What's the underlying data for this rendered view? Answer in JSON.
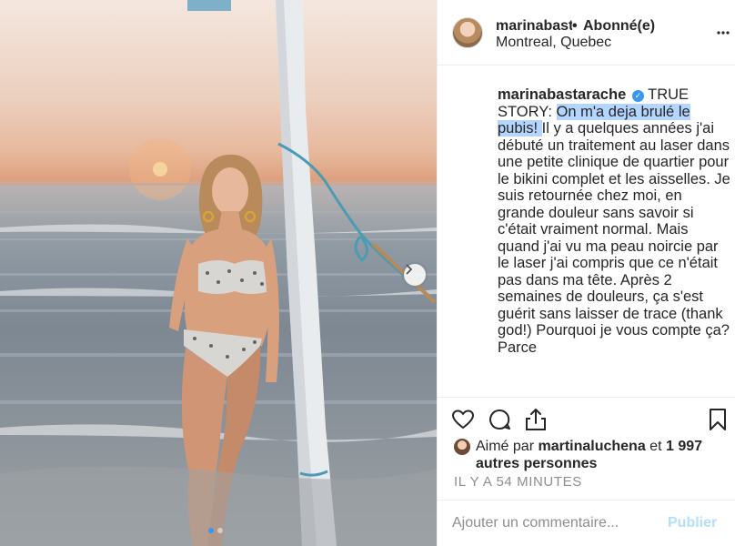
{
  "post": {
    "photo_alt": "",
    "carousel": {
      "count": 2,
      "active_index": 0
    }
  },
  "header": {
    "username": "marinabastarache",
    "separator": "•",
    "follow_status": "Abonné(e)",
    "location": "Montreal, Quebec"
  },
  "caption": {
    "username": "marinabastarache",
    "verified": "✓",
    "text_before": " TRUE STORY: ",
    "text_highlight": "On m'a deja brulé le pubis! ",
    "text_after": "Il y a quelques années j'ai débuté un traitement au laser dans une petite clinique de quartier pour le bikini complet et les aisselles. Je suis retournée chez moi, en grande douleur sans savoir si c'était vraiment normal. Mais quand j'ai vu ma peau noircie par le laser j'ai compris que ce n'était pas dans ma tête. Après 2 semaines de douleurs, ça s'est guérit sans laisser de trace (thank god!) Pourquoi je vous compte ça? Parce"
  },
  "actions": {
    "like_icon": "heart-icon",
    "comment_icon": "comment-bubble-icon",
    "share_icon": "share-icon",
    "save_icon": "bookmark-icon"
  },
  "likes": {
    "prefix": "Aimé par ",
    "user": "martinaluchena",
    "conjunction": " et ",
    "others": "1 997 autres personnes"
  },
  "timestamp": "IL Y A 54 MINUTES",
  "comment": {
    "placeholder": "Ajouter un commentaire...",
    "publish_label": "Publier"
  },
  "colors": {
    "accent": "#3897f0",
    "publish_disabled": "#b2dffc",
    "highlight": "#b4d5fe",
    "muted_text": "#8e8e8e"
  }
}
